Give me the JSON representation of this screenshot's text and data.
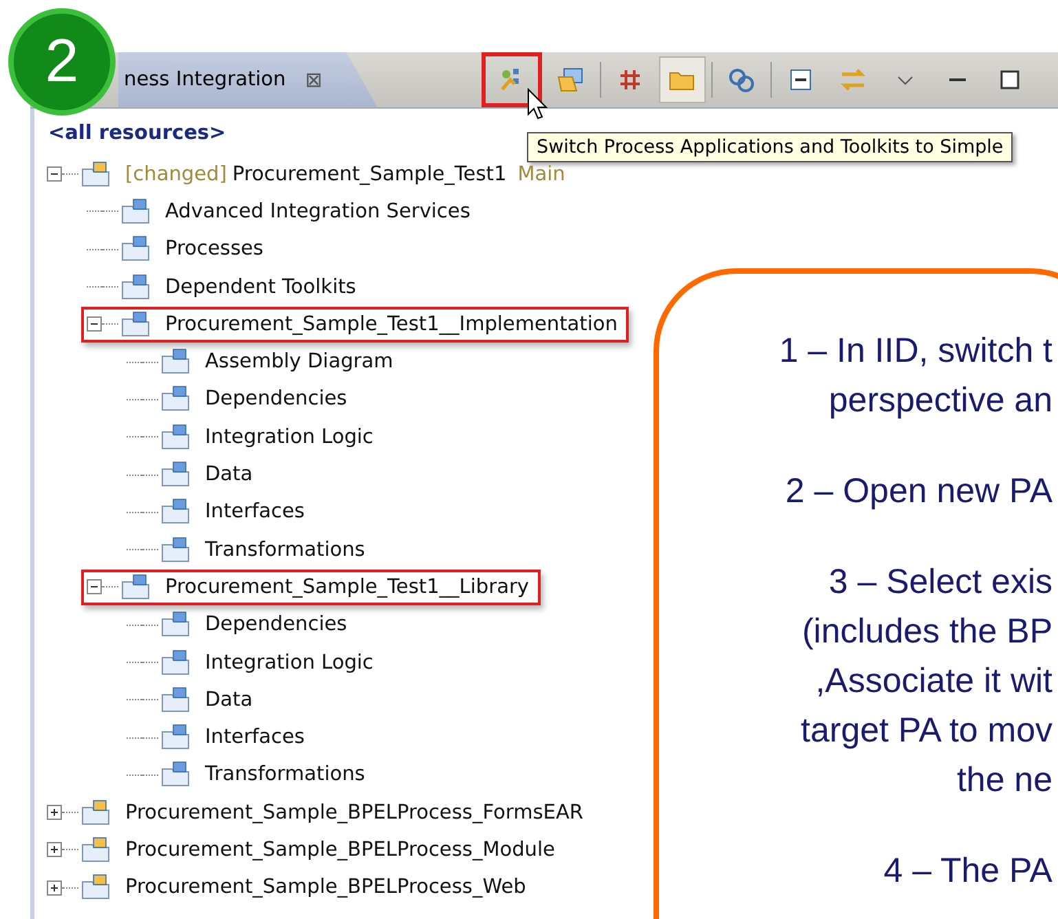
{
  "step_badge": "2",
  "view_tab": {
    "title": "ness Integration",
    "close": "⊠"
  },
  "toolbar": [
    {
      "kind": "switch",
      "highlighted": true,
      "pressed": false
    },
    {
      "kind": "open",
      "highlighted": false,
      "pressed": false
    },
    {
      "kind": "separator"
    },
    {
      "kind": "grid",
      "highlighted": false,
      "pressed": false
    },
    {
      "kind": "folder",
      "highlighted": false,
      "pressed": true
    },
    {
      "kind": "separator"
    },
    {
      "kind": "link",
      "highlighted": false,
      "pressed": false
    },
    {
      "kind": "separator"
    },
    {
      "kind": "collapse",
      "highlighted": false,
      "pressed": false
    },
    {
      "kind": "sync",
      "highlighted": false,
      "pressed": false
    },
    {
      "kind": "menu",
      "highlighted": false,
      "pressed": false
    },
    {
      "kind": "minimize",
      "highlighted": false,
      "pressed": false
    },
    {
      "kind": "maximize",
      "highlighted": false,
      "pressed": false
    }
  ],
  "tooltip": "Switch Process Applications and Toolkits to Simple",
  "filter": "<all resources>",
  "tree": [
    {
      "tag": "[changed]",
      "label": "Procurement_Sample_Test1",
      "branch": "Main",
      "expanded": true,
      "highlighted": false,
      "children": [
        {
          "label": "Advanced Integration Services",
          "highlighted": false
        },
        {
          "label": "Processes",
          "highlighted": false
        },
        {
          "label": "Dependent Toolkits",
          "highlighted": false
        },
        {
          "label": "Procurement_Sample_Test1__Implementation",
          "expanded": true,
          "highlighted": true,
          "children": [
            {
              "label": "Assembly Diagram",
              "highlighted": false
            },
            {
              "label": "Dependencies",
              "highlighted": false
            },
            {
              "label": "Integration Logic",
              "highlighted": false
            },
            {
              "label": "Data",
              "highlighted": false
            },
            {
              "label": "Interfaces",
              "highlighted": false
            },
            {
              "label": "Transformations",
              "highlighted": false
            }
          ]
        },
        {
          "label": "Procurement_Sample_Test1__Library",
          "expanded": true,
          "highlighted": true,
          "children": [
            {
              "label": "Dependencies",
              "highlighted": false
            },
            {
              "label": "Integration Logic",
              "highlighted": false
            },
            {
              "label": "Data",
              "highlighted": false
            },
            {
              "label": "Interfaces",
              "highlighted": false
            },
            {
              "label": "Transformations",
              "highlighted": false
            }
          ]
        }
      ]
    },
    {
      "label": "Procurement_Sample_BPELProcess_FormsEAR",
      "expanded": false,
      "highlighted": false
    },
    {
      "label": "Procurement_Sample_BPELProcess_Module",
      "expanded": false,
      "highlighted": false
    },
    {
      "label": "Procurement_Sample_BPELProcess_Web",
      "expanded": false,
      "highlighted": false
    }
  ],
  "callout": {
    "steps": [
      [
        "1 – In IID, switch t",
        "perspective an"
      ],
      [
        "2 – Open new PA"
      ],
      [
        "3 – Select exis",
        "(includes the BP",
        ",Associate it wit",
        "target PA to mov",
        "the ne"
      ],
      [
        "4 – The PA"
      ]
    ]
  }
}
